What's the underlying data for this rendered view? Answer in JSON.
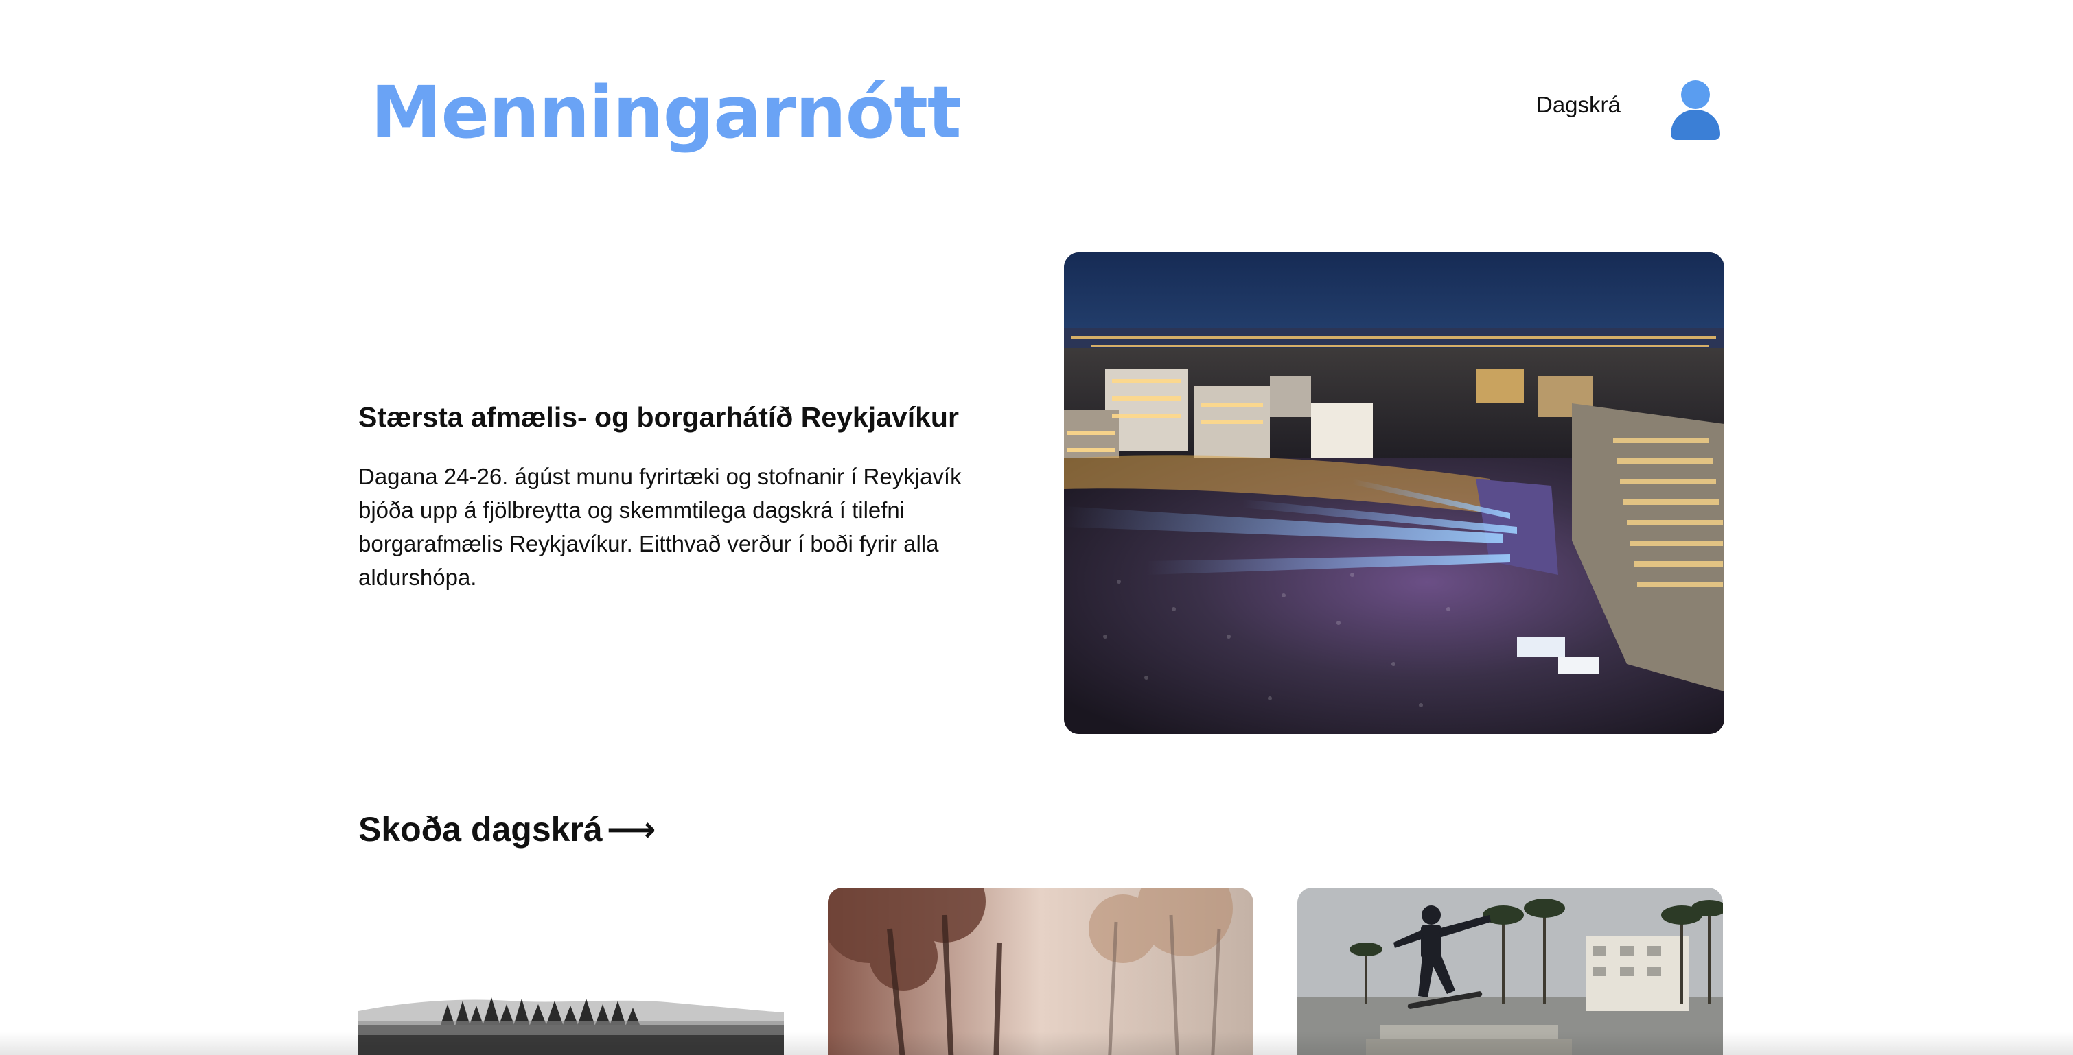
{
  "header": {
    "logo": "Menningarnótt",
    "nav": {
      "program_label": "Dagskrá"
    },
    "avatar_icon": "user-avatar-icon",
    "colors": {
      "brand": "#6aa3f5",
      "avatar": "#3b7fd6"
    }
  },
  "hero": {
    "title": "Stærsta afmælis- og borgarhátíð Reykjavíkur",
    "text": "Dagana 24-26. ágúst munu fyrirtæki og stofnanir í Reykjavík bjóða upp á fjölbreytta og skemmtilega dagskrá í tilefni borgarafmælis Reykjavíkur. Eitthvað verður í boði fyrir alla aldurshópa.",
    "image": "aerial night concert crowd in Reykjavík"
  },
  "program": {
    "link_label": "Skoða dagskrá",
    "arrow_icon": "arrow-right-icon"
  },
  "cards": [
    {
      "image": "misty forest treeline photo"
    },
    {
      "image": "autumn foggy forest photo"
    },
    {
      "image": "skateboarder at palm-lined skatepark photo"
    }
  ]
}
